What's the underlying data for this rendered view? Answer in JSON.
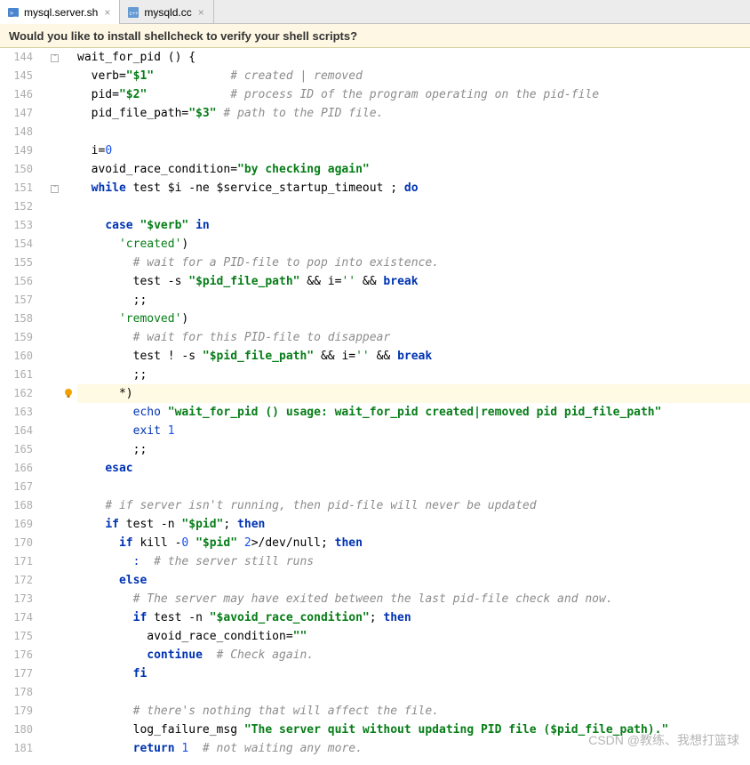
{
  "tabs": [
    {
      "label": "mysql.server.sh",
      "icon": "shell-file-icon",
      "active": true
    },
    {
      "label": "mysqld.cc",
      "icon": "cpp-file-icon",
      "active": false
    }
  ],
  "banner": {
    "text": "Would you like to install shellcheck to verify your shell scripts?"
  },
  "watermark": "CSDN @教练、我想打篮球",
  "bulb_line_index": 18,
  "lines": [
    {
      "n": 144,
      "fold": true,
      "seg": [
        [
          "fn",
          "wait_for_pid"
        ],
        [
          "op",
          " () {"
        ]
      ]
    },
    {
      "n": 145,
      "seg": [
        [
          "op",
          "  "
        ],
        [
          "var",
          "verb"
        ],
        [
          "op",
          "="
        ],
        [
          "str",
          "\"$1\""
        ],
        [
          "op",
          "           "
        ],
        [
          "cmt",
          "# created | removed"
        ]
      ]
    },
    {
      "n": 146,
      "seg": [
        [
          "op",
          "  "
        ],
        [
          "var",
          "pid"
        ],
        [
          "op",
          "="
        ],
        [
          "str",
          "\"$2\""
        ],
        [
          "op",
          "            "
        ],
        [
          "cmt",
          "# process ID of the program operating on the pid-file"
        ]
      ]
    },
    {
      "n": 147,
      "seg": [
        [
          "op",
          "  "
        ],
        [
          "var",
          "pid_file_path"
        ],
        [
          "op",
          "="
        ],
        [
          "str",
          "\"$3\""
        ],
        [
          "op",
          " "
        ],
        [
          "cmt",
          "# path to the PID file."
        ]
      ]
    },
    {
      "n": 148,
      "seg": []
    },
    {
      "n": 149,
      "seg": [
        [
          "op",
          "  "
        ],
        [
          "var",
          "i"
        ],
        [
          "op",
          "="
        ],
        [
          "num",
          "0"
        ]
      ]
    },
    {
      "n": 150,
      "seg": [
        [
          "op",
          "  "
        ],
        [
          "var",
          "avoid_race_condition"
        ],
        [
          "op",
          "="
        ],
        [
          "str",
          "\"by checking again\""
        ]
      ]
    },
    {
      "n": 151,
      "fold": true,
      "seg": [
        [
          "op",
          "  "
        ],
        [
          "kw",
          "while"
        ],
        [
          "op",
          " "
        ],
        [
          "fn",
          "test"
        ],
        [
          "op",
          " $i -ne $service_startup_timeout ; "
        ],
        [
          "kw",
          "do"
        ]
      ]
    },
    {
      "n": 152,
      "seg": []
    },
    {
      "n": 153,
      "seg": [
        [
          "op",
          "    "
        ],
        [
          "kw",
          "case"
        ],
        [
          "op",
          " "
        ],
        [
          "str",
          "\"$verb\""
        ],
        [
          "op",
          " "
        ],
        [
          "kw",
          "in"
        ]
      ]
    },
    {
      "n": 154,
      "seg": [
        [
          "op",
          "      "
        ],
        [
          "str2",
          "'created'"
        ],
        [
          "op",
          ")"
        ]
      ]
    },
    {
      "n": 155,
      "seg": [
        [
          "op",
          "        "
        ],
        [
          "cmt",
          "# wait for a PID-file to pop into existence."
        ]
      ]
    },
    {
      "n": 156,
      "seg": [
        [
          "op",
          "        "
        ],
        [
          "fn",
          "test"
        ],
        [
          "op",
          " -s "
        ],
        [
          "str",
          "\"$pid_file_path\""
        ],
        [
          "op",
          " && "
        ],
        [
          "var",
          "i"
        ],
        [
          "op",
          "="
        ],
        [
          "str2",
          "''"
        ],
        [
          "op",
          " && "
        ],
        [
          "kw",
          "break"
        ]
      ]
    },
    {
      "n": 157,
      "seg": [
        [
          "op",
          "        ;;"
        ]
      ]
    },
    {
      "n": 158,
      "seg": [
        [
          "op",
          "      "
        ],
        [
          "str2",
          "'removed'"
        ],
        [
          "op",
          ")"
        ]
      ]
    },
    {
      "n": 159,
      "seg": [
        [
          "op",
          "        "
        ],
        [
          "cmt",
          "# wait for this PID-file to disappear"
        ]
      ]
    },
    {
      "n": 160,
      "seg": [
        [
          "op",
          "        "
        ],
        [
          "fn",
          "test"
        ],
        [
          "op",
          " ! -s "
        ],
        [
          "str",
          "\"$pid_file_path\""
        ],
        [
          "op",
          " && "
        ],
        [
          "var",
          "i"
        ],
        [
          "op",
          "="
        ],
        [
          "str2",
          "''"
        ],
        [
          "op",
          " && "
        ],
        [
          "kw",
          "break"
        ]
      ]
    },
    {
      "n": 161,
      "seg": [
        [
          "op",
          "        ;;"
        ]
      ]
    },
    {
      "n": 162,
      "hl": true,
      "seg": [
        [
          "op",
          "      *)"
        ]
      ]
    },
    {
      "n": 163,
      "seg": [
        [
          "op",
          "        "
        ],
        [
          "kw2",
          "echo"
        ],
        [
          "op",
          " "
        ],
        [
          "str",
          "\"wait_for_pid () usage: wait_for_pid created|removed pid pid_file_path\""
        ]
      ]
    },
    {
      "n": 164,
      "seg": [
        [
          "op",
          "        "
        ],
        [
          "kw2",
          "exit"
        ],
        [
          "op",
          " "
        ],
        [
          "num",
          "1"
        ]
      ]
    },
    {
      "n": 165,
      "seg": [
        [
          "op",
          "        ;;"
        ]
      ]
    },
    {
      "n": 166,
      "seg": [
        [
          "op",
          "    "
        ],
        [
          "kw",
          "esac"
        ]
      ]
    },
    {
      "n": 167,
      "seg": []
    },
    {
      "n": 168,
      "seg": [
        [
          "op",
          "    "
        ],
        [
          "cmt",
          "# if server isn't running, then pid-file will never be updated"
        ]
      ]
    },
    {
      "n": 169,
      "seg": [
        [
          "op",
          "    "
        ],
        [
          "kw",
          "if"
        ],
        [
          "op",
          " "
        ],
        [
          "fn",
          "test"
        ],
        [
          "op",
          " -n "
        ],
        [
          "str",
          "\"$pid\""
        ],
        [
          "op",
          "; "
        ],
        [
          "kw",
          "then"
        ]
      ]
    },
    {
      "n": 170,
      "seg": [
        [
          "op",
          "      "
        ],
        [
          "kw",
          "if"
        ],
        [
          "op",
          " "
        ],
        [
          "fn",
          "kill"
        ],
        [
          "op",
          " -"
        ],
        [
          "num",
          "0"
        ],
        [
          "op",
          " "
        ],
        [
          "str",
          "\"$pid\""
        ],
        [
          "op",
          " "
        ],
        [
          "num",
          "2"
        ],
        [
          "op",
          ">/dev/null; "
        ],
        [
          "kw",
          "then"
        ]
      ]
    },
    {
      "n": 171,
      "seg": [
        [
          "op",
          "        "
        ],
        [
          "kw2",
          ":"
        ],
        [
          "op",
          "  "
        ],
        [
          "cmt",
          "# the server still runs"
        ]
      ]
    },
    {
      "n": 172,
      "seg": [
        [
          "op",
          "      "
        ],
        [
          "kw",
          "else"
        ]
      ]
    },
    {
      "n": 173,
      "seg": [
        [
          "op",
          "        "
        ],
        [
          "cmt",
          "# The server may have exited between the last pid-file check and now."
        ]
      ]
    },
    {
      "n": 174,
      "seg": [
        [
          "op",
          "        "
        ],
        [
          "kw",
          "if"
        ],
        [
          "op",
          " "
        ],
        [
          "fn",
          "test"
        ],
        [
          "op",
          " -n "
        ],
        [
          "str",
          "\"$avoid_race_condition\""
        ],
        [
          "op",
          "; "
        ],
        [
          "kw",
          "then"
        ]
      ]
    },
    {
      "n": 175,
      "seg": [
        [
          "op",
          "          "
        ],
        [
          "var",
          "avoid_race_condition"
        ],
        [
          "op",
          "="
        ],
        [
          "str",
          "\"\""
        ]
      ]
    },
    {
      "n": 176,
      "seg": [
        [
          "op",
          "          "
        ],
        [
          "kw",
          "continue"
        ],
        [
          "op",
          "  "
        ],
        [
          "cmt",
          "# Check again."
        ]
      ]
    },
    {
      "n": 177,
      "seg": [
        [
          "op",
          "        "
        ],
        [
          "kw",
          "fi"
        ]
      ]
    },
    {
      "n": 178,
      "seg": []
    },
    {
      "n": 179,
      "seg": [
        [
          "op",
          "        "
        ],
        [
          "cmt",
          "# there's nothing that will affect the file."
        ]
      ]
    },
    {
      "n": 180,
      "seg": [
        [
          "op",
          "        "
        ],
        [
          "fn",
          "log_failure_msg"
        ],
        [
          "op",
          " "
        ],
        [
          "str",
          "\"The server quit without updating PID file ($pid_file_path).\""
        ]
      ]
    },
    {
      "n": 181,
      "seg": [
        [
          "op",
          "        "
        ],
        [
          "kw",
          "return"
        ],
        [
          "op",
          " "
        ],
        [
          "num",
          "1"
        ],
        [
          "op",
          "  "
        ],
        [
          "cmt",
          "# not waiting any more."
        ]
      ]
    }
  ]
}
